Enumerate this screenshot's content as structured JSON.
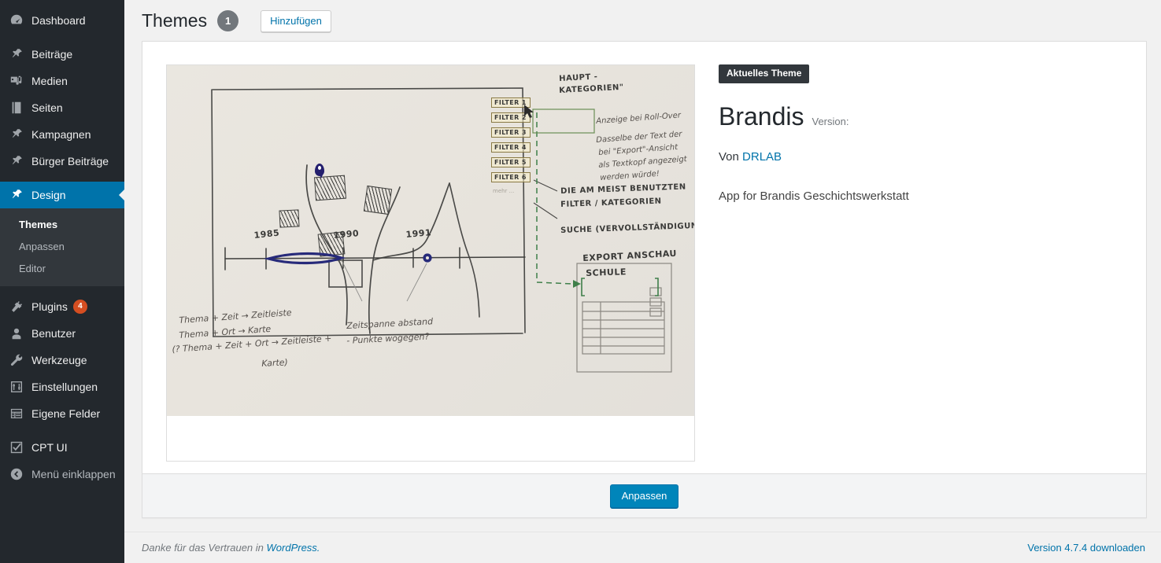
{
  "sidebar": {
    "items": [
      {
        "label": "Dashboard",
        "icon": "dashboard-icon",
        "name": "dashboard"
      },
      {
        "label": "Beiträge",
        "icon": "pin-icon",
        "name": "beitraege"
      },
      {
        "label": "Medien",
        "icon": "media-icon",
        "name": "medien"
      },
      {
        "label": "Seiten",
        "icon": "pages-icon",
        "name": "seiten"
      },
      {
        "label": "Kampagnen",
        "icon": "pin-icon",
        "name": "kampagnen"
      },
      {
        "label": "Bürger Beiträge",
        "icon": "pin-icon",
        "name": "buerger-beitraege"
      },
      {
        "label": "Design",
        "icon": "appearance-icon",
        "name": "design",
        "current": true
      },
      {
        "label": "Plugins",
        "icon": "plugins-icon",
        "name": "plugins",
        "badge": "4"
      },
      {
        "label": "Benutzer",
        "icon": "users-icon",
        "name": "benutzer"
      },
      {
        "label": "Werkzeuge",
        "icon": "tools-icon",
        "name": "werkzeuge"
      },
      {
        "label": "Einstellungen",
        "icon": "settings-icon",
        "name": "einstellungen"
      },
      {
        "label": "Eigene Felder",
        "icon": "custom-fields-icon",
        "name": "eigene-felder"
      },
      {
        "label": "CPT UI",
        "icon": "checkbox-icon",
        "name": "cpt-ui"
      },
      {
        "label": "Menü einklappen",
        "icon": "collapse-icon",
        "name": "collapse-menu"
      }
    ],
    "submenu": [
      {
        "label": "Themes",
        "current": true
      },
      {
        "label": "Anpassen",
        "current": false
      },
      {
        "label": "Editor",
        "current": false
      }
    ],
    "colors": {
      "background": "#23282d",
      "submenu_background": "#32373c",
      "current_highlight": "#0073aa",
      "badge": "#d54e21"
    }
  },
  "header": {
    "title": "Themes",
    "count": "1",
    "add_button": "Hinzufügen"
  },
  "theme": {
    "current_label": "Aktuelles Theme",
    "name": "Brandis",
    "version_label": "Version:",
    "version_value": "",
    "author_prefix": "Von",
    "author": "DRLAB",
    "description": "App for Brandis Geschichtswerkstatt",
    "customize_button": "Anpassen",
    "screenshot_alt": "Handgezeichnete Skizze: Karte mit Zeitleiste, Filterliste und Export-Ansicht"
  },
  "screenshot_sketch": {
    "filters": [
      "FILTER 1",
      "FILTER 2",
      "FILTER 3",
      "FILTER 4",
      "FILTER 5",
      "FILTER 6"
    ],
    "filters_more": "mehr ...",
    "notes": {
      "main_categories": "HAUPT -",
      "main_categories2": "KATEGORIEN\"",
      "rollover": "Anzeige bei Roll-Over",
      "rollover2": "Dasselbe der Text der",
      "rollover3": "bei \"Export\"-Ansicht",
      "rollover4": "als Textkopf angezeigt",
      "rollover5": "werden würde!",
      "most_used1": "DIE AM MEIST BENUTZTEN",
      "most_used2": "FILTER / KATEGORIEN",
      "search": "SUCHE (VERVOLLSTÄNDIGUNG)",
      "export_title": "EXPORT ANSCHAU",
      "export_subtitle": "SCHULE",
      "bottom1": "Thema + Zeit → Zeitleiste",
      "bottom2": "Thema + Ort → Karte",
      "bottom3": "(? Thema + Zeit + Ort → Zeitleiste +",
      "bottom4": "Karte)",
      "bottom5": "Zeitspanne abstand",
      "bottom6": "- Punkte wogegen?"
    },
    "timeline_years": [
      "1985",
      "1990",
      "1991"
    ]
  },
  "footer": {
    "thanks_prefix": "Danke für das Vertrauen in",
    "thanks_link": "WordPress.",
    "version_link": "Version 4.7.4 downloaden"
  }
}
